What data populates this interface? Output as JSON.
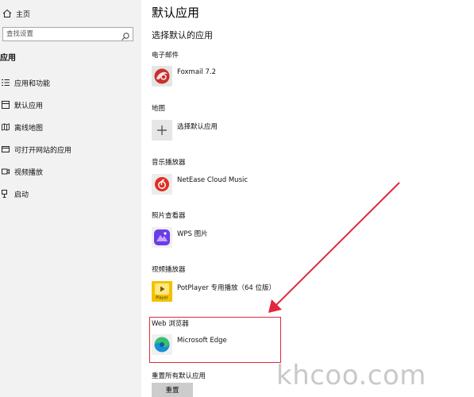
{
  "sidebar": {
    "home_label": "主页",
    "search_placeholder": "查找设置",
    "section_title": "应用",
    "items": [
      {
        "label": "应用和功能",
        "icon": "apps-list-icon"
      },
      {
        "label": "默认应用",
        "icon": "default-apps-icon"
      },
      {
        "label": "离线地图",
        "icon": "offline-maps-icon"
      },
      {
        "label": "可打开网站的应用",
        "icon": "apps-for-websites-icon"
      },
      {
        "label": "视频播放",
        "icon": "video-playback-icon"
      },
      {
        "label": "启动",
        "icon": "startup-icon"
      }
    ]
  },
  "main": {
    "title": "默认应用",
    "subtitle": "选择默认的应用",
    "categories": [
      {
        "label": "电子邮件",
        "app": "Foxmail 7.2",
        "icon": "foxmail-icon"
      },
      {
        "label": "地图",
        "app": "选择默认应用",
        "icon": "plus-icon"
      },
      {
        "label": "音乐播放器",
        "app": "NetEase Cloud Music",
        "icon": "netease-cloud-music-icon"
      },
      {
        "label": "照片查看器",
        "app": "WPS 图片",
        "icon": "wps-pictures-icon"
      },
      {
        "label": "视频播放器",
        "app": "PotPlayer 专用播放（64 位版）",
        "icon": "potplayer-icon"
      },
      {
        "label": "Web 浏览器",
        "app": "Microsoft Edge",
        "icon": "edge-icon"
      }
    ],
    "reset_label": "重置所有默认应用",
    "reset_button": "重置",
    "potplayer_tile_text": "Player"
  },
  "annotation": {
    "color": "#e0283a"
  },
  "watermark": "khcoo.com"
}
